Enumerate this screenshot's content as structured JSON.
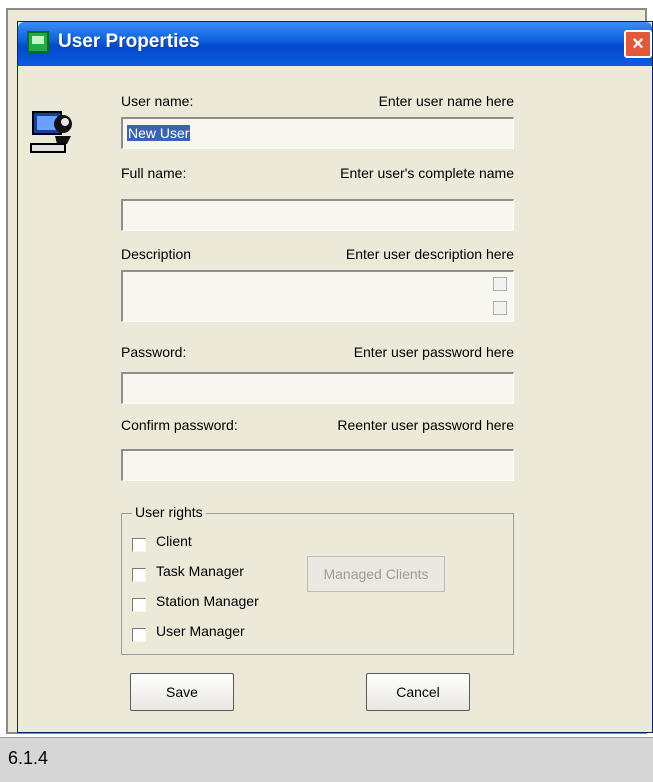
{
  "window": {
    "title": "User Properties",
    "close_symbol": "×"
  },
  "fields": {
    "user_name": {
      "label": "User name:",
      "hint": "Enter user name here",
      "value": "New User"
    },
    "full_name": {
      "label": "Full name:",
      "hint": "Enter user's complete name",
      "value": ""
    },
    "description": {
      "label": "Description",
      "hint": "Enter user description here",
      "value": ""
    },
    "password": {
      "label": "Password:",
      "hint": "Enter user password here",
      "value": ""
    },
    "confirm_password": {
      "label": "Confirm password:",
      "hint": "Reenter user password here",
      "value": ""
    }
  },
  "user_rights": {
    "legend": "User rights",
    "items": [
      {
        "label": "Client",
        "checked": false
      },
      {
        "label": "Task Manager",
        "checked": false
      },
      {
        "label": "Station Manager",
        "checked": false
      },
      {
        "label": "User Manager",
        "checked": false
      }
    ],
    "managed_clients_button": "Managed Clients"
  },
  "buttons": {
    "save": "Save",
    "cancel": "Cancel"
  },
  "caption": "6.1.4",
  "colors": {
    "title_bar": "#0a5cdc",
    "dialog_bg": "#ece9d8",
    "selection": "#3a63b7"
  },
  "icons": [
    "app-icon",
    "user-computer-icon",
    "close-icon",
    "scroll-up-icon",
    "scroll-down-icon"
  ]
}
